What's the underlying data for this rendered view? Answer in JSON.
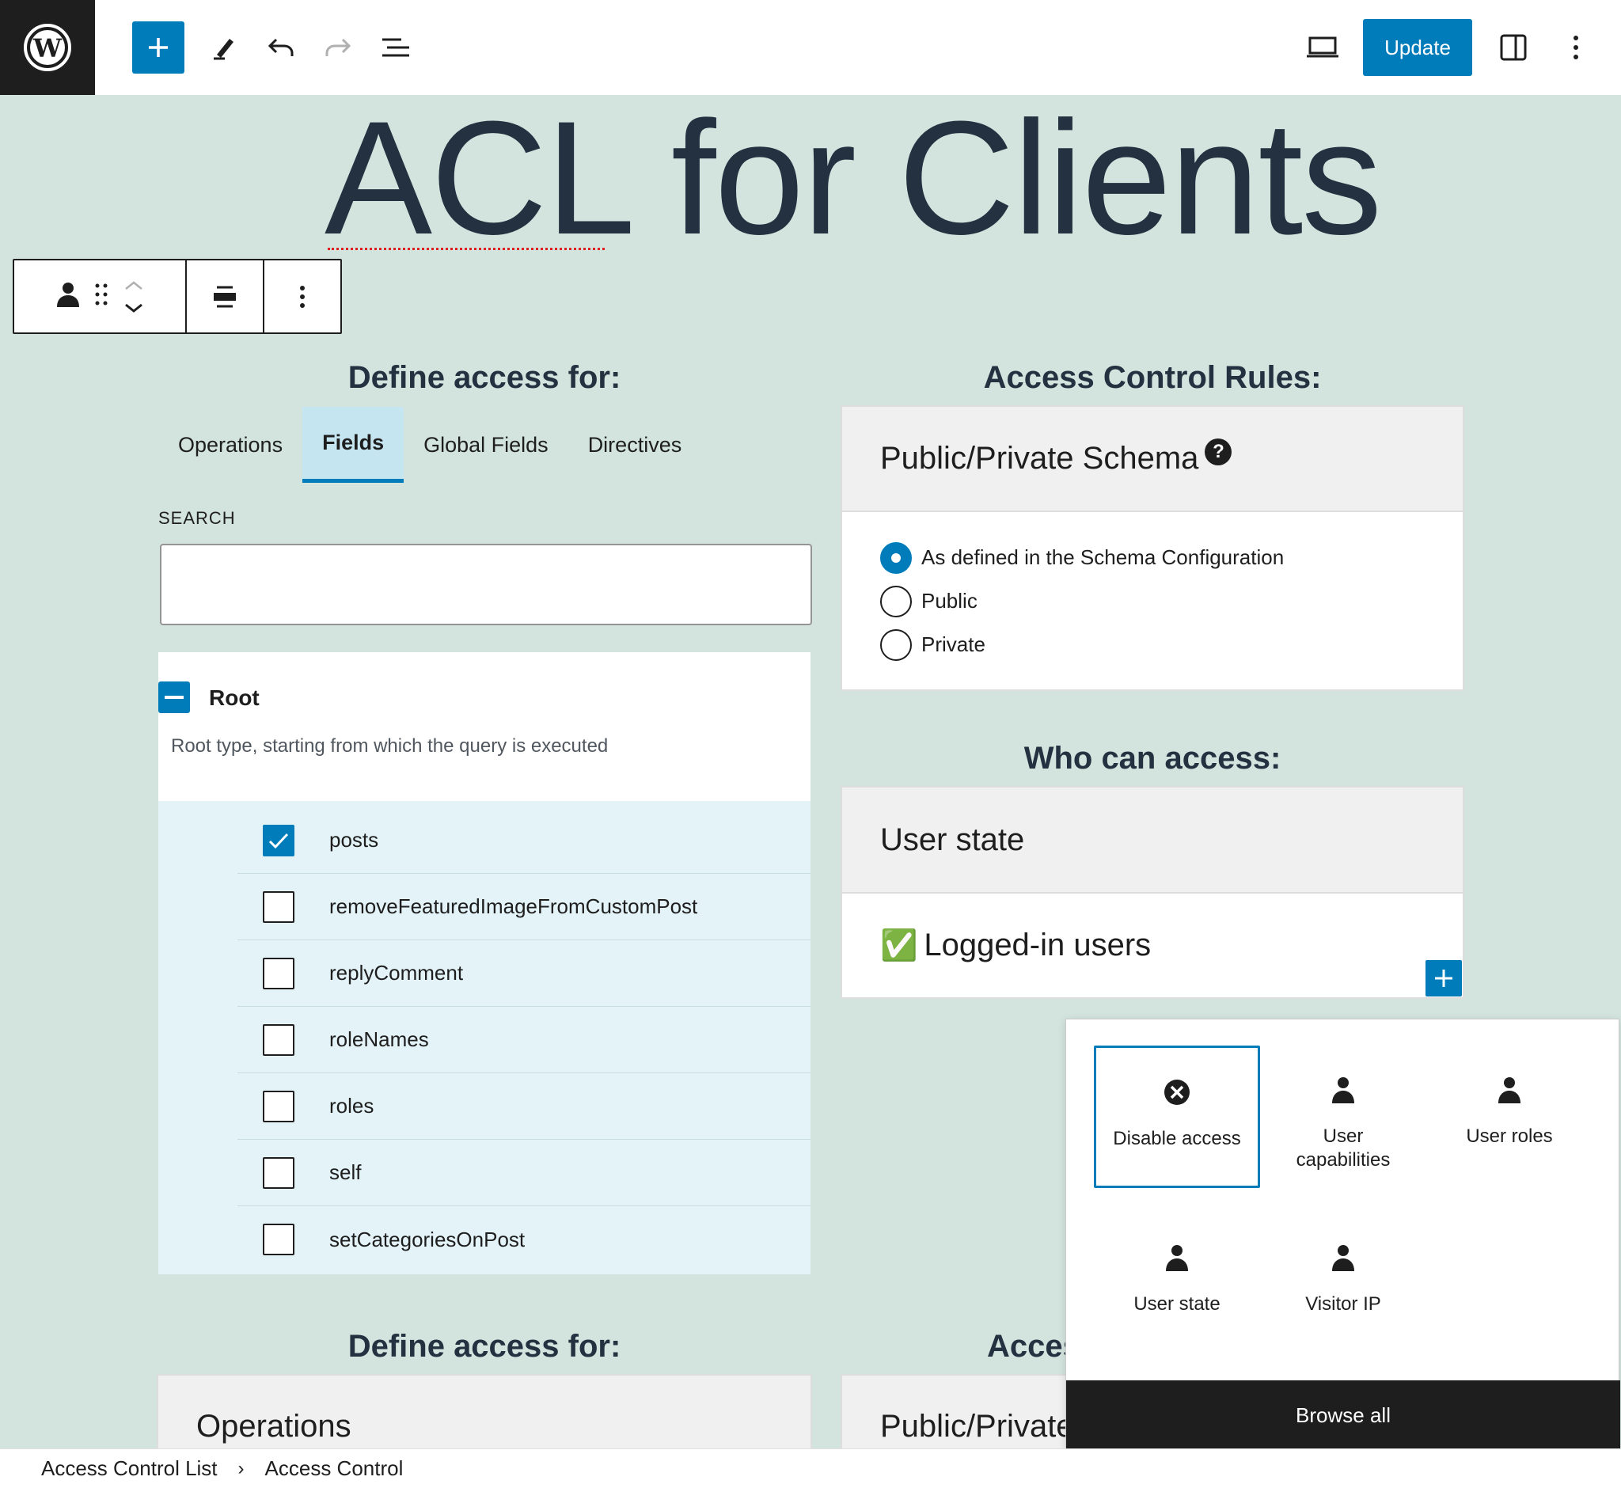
{
  "toolbar": {
    "update_label": "Update",
    "icons": [
      "wordpress-logo",
      "plus-icon",
      "pencil-icon",
      "undo-icon",
      "redo-icon",
      "list-view-icon",
      "desktop-preview-icon",
      "sidebar-toggle-icon",
      "more-vertical-icon"
    ]
  },
  "page": {
    "title": "ACL for Clients"
  },
  "access_for": {
    "heading": "Define access for:",
    "tabs": [
      {
        "label": "Operations",
        "active": false
      },
      {
        "label": "Fields",
        "active": true
      },
      {
        "label": "Global Fields",
        "active": false
      },
      {
        "label": "Directives",
        "active": false
      }
    ],
    "search_label": "SEARCH",
    "search_value": "",
    "root": {
      "label": "Root",
      "description": "Root type, starting from which the query is executed"
    },
    "fields": [
      {
        "label": "posts",
        "checked": true
      },
      {
        "label": "removeFeaturedImageFromCustomPost",
        "checked": false
      },
      {
        "label": "replyComment",
        "checked": false
      },
      {
        "label": "roleNames",
        "checked": false
      },
      {
        "label": "roles",
        "checked": false
      },
      {
        "label": "self",
        "checked": false
      },
      {
        "label": "setCategoriesOnPost",
        "checked": false
      }
    ]
  },
  "rules": {
    "heading": "Access Control Rules:",
    "schema_panel": {
      "title": "Public/Private Schema",
      "help_icon": "?",
      "options": [
        {
          "label": "As defined in the Schema Configuration",
          "selected": true
        },
        {
          "label": "Public",
          "selected": false
        },
        {
          "label": "Private",
          "selected": false
        }
      ]
    },
    "who_heading": "Who can access:",
    "user_state_panel": {
      "title": "User state",
      "value_emoji": "✅",
      "value": "Logged-in users"
    }
  },
  "bottom": {
    "heading_left": "Define access for:",
    "heading_right_partial": "Acces",
    "panel_left": "Operations",
    "panel_right_partial": "Public/Private"
  },
  "inserter": {
    "items": [
      {
        "label": "Disable access",
        "icon": "close-circle-icon",
        "focused": true
      },
      {
        "label": "User capabilities",
        "icon": "user-icon",
        "focused": false
      },
      {
        "label": "User roles",
        "icon": "user-icon",
        "focused": false
      },
      {
        "label": "User state",
        "icon": "user-icon",
        "focused": false
      },
      {
        "label": "Visitor IP",
        "icon": "user-icon",
        "focused": false
      }
    ],
    "browse_all_label": "Browse all"
  },
  "breadcrumb": {
    "items": [
      "Access Control List",
      "Access Control"
    ],
    "separator": "›"
  },
  "colors": {
    "accent": "#007cba",
    "canvas": "#d3e4df",
    "title": "#243140"
  }
}
